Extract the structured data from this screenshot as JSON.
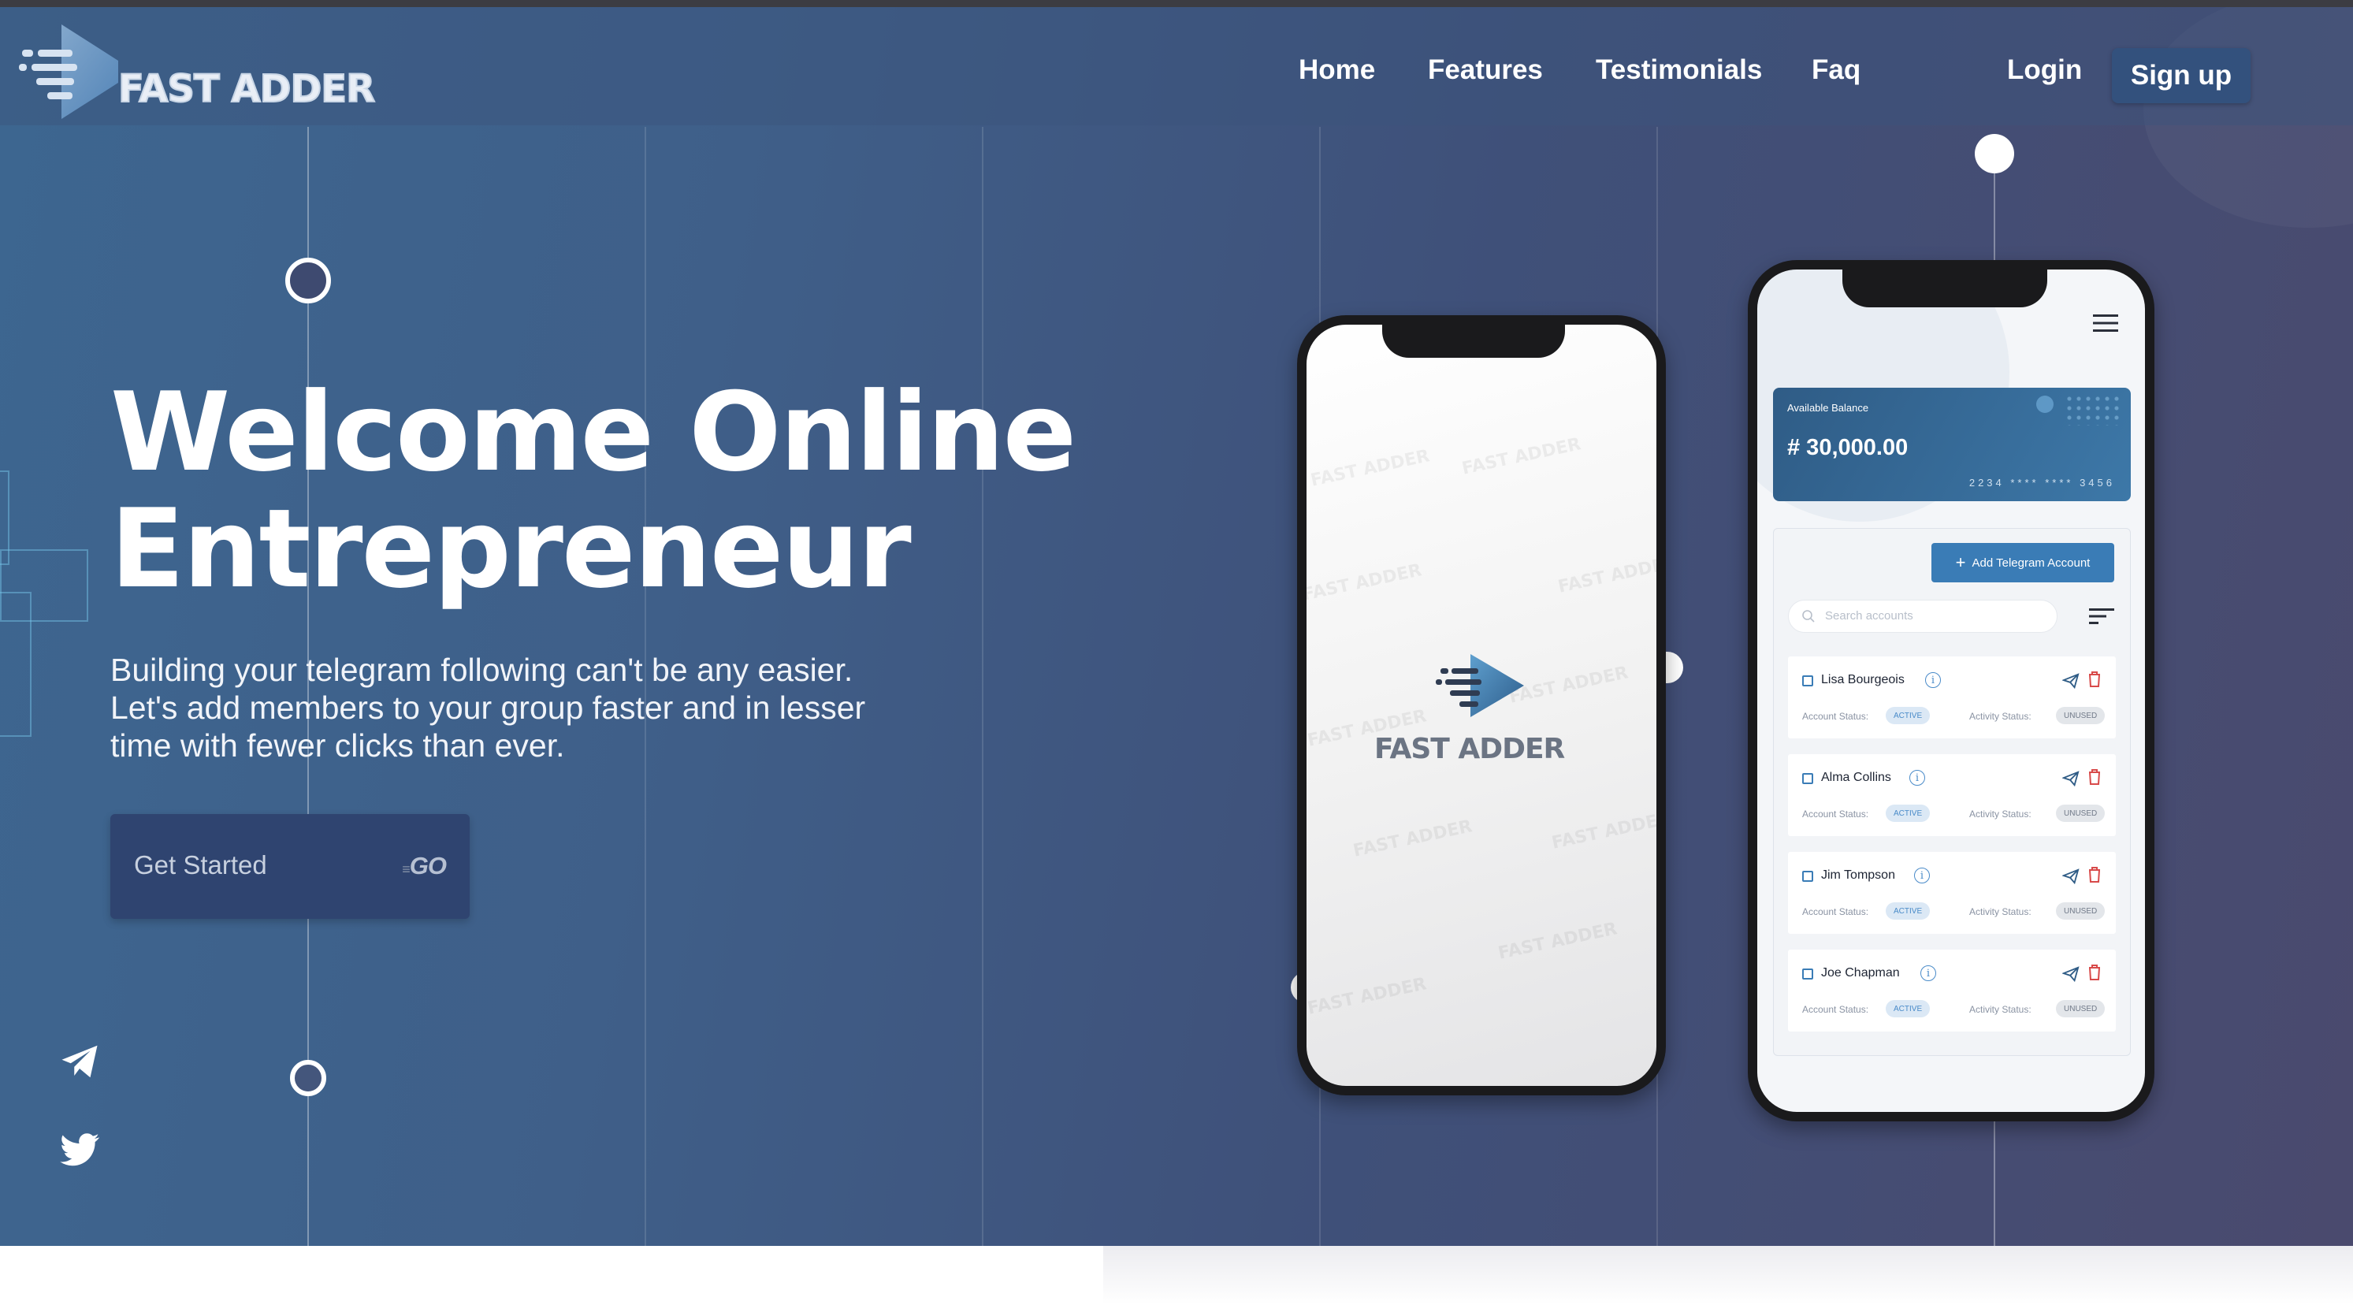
{
  "brand": {
    "name": "FAST ADDER"
  },
  "nav": {
    "items": [
      {
        "id": "home",
        "label": "Home"
      },
      {
        "id": "features",
        "label": "Features"
      },
      {
        "id": "testimonials",
        "label": "Testimonials"
      },
      {
        "id": "faq",
        "label": "Faq"
      }
    ],
    "login_label": "Login",
    "signup_label": "Sign up"
  },
  "hero": {
    "headline_line1": "Welcome Online",
    "headline_line2": "Entrepreneur",
    "subtext_line1": "Building your telegram following can't be any easier.",
    "subtext_line2": "Let's add members to your group faster and in lesser",
    "subtext_line3": "time with fewer clicks than ever.",
    "cta_label": "Get Started",
    "cta_badge": "GO"
  },
  "social": {
    "icons": [
      "telegram-icon",
      "twitter-icon"
    ]
  },
  "phone_splash": {
    "logo_text": "FAST ADDER",
    "watermark": "FAST ADDER"
  },
  "phone_app": {
    "balance_label": "Available Balance",
    "balance_amount": "# 30,000.00",
    "card_number": "2234 **** **** 3456",
    "add_button_label": "Add Telegram Account",
    "search_placeholder": "Search accounts",
    "account_status_label": "Account Status:",
    "activity_status_label": "Activity Status:",
    "accounts": [
      {
        "name": "Lisa Bourgeois",
        "account_status": "ACTIVE",
        "activity_status": "UNUSED"
      },
      {
        "name": "Alma Collins",
        "account_status": "ACTIVE",
        "activity_status": "UNUSED"
      },
      {
        "name": "Jim Tompson",
        "account_status": "ACTIVE",
        "activity_status": "UNUSED"
      },
      {
        "name": "Joe Chapman",
        "account_status": "ACTIVE",
        "activity_status": "UNUSED"
      }
    ]
  },
  "colors": {
    "hero_blue": "#3d6690",
    "hero_purple": "#4a4a6e",
    "cta_bg": "#2f4470",
    "accent": "#3a7cb6",
    "delete_red": "#d84a4a"
  }
}
